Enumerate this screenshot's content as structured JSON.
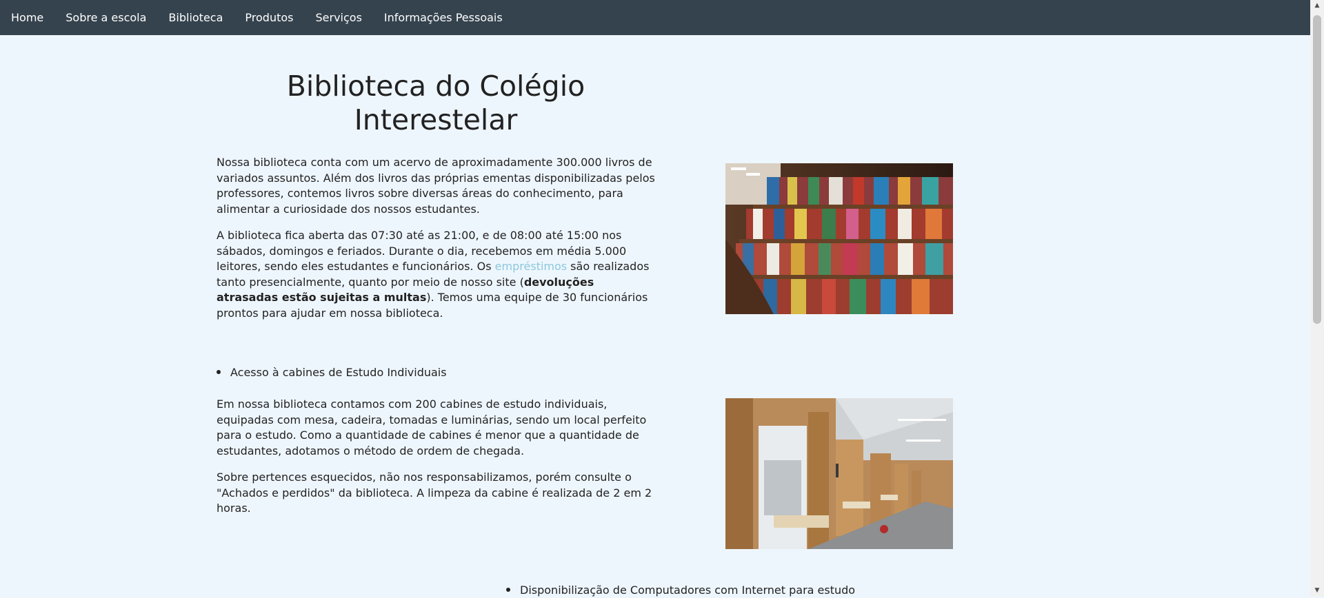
{
  "nav": {
    "items": [
      {
        "label": "Home"
      },
      {
        "label": "Sobre a escola"
      },
      {
        "label": "Biblioteca"
      },
      {
        "label": "Produtos"
      },
      {
        "label": "Serviços"
      },
      {
        "label": "Informações Pessoais"
      }
    ]
  },
  "main": {
    "title": "Biblioteca do Colégio Interestelar",
    "section1": {
      "p1": "Nossa biblioteca conta com um acervo de aproximadamente 300.000 livros de variados assuntos. Além dos livros das próprias ementas disponibilizadas pelos professores, contemos livros sobre diversas áreas do conhecimento, para alimentar a curiosidade dos nossos estudantes.",
      "p2_part1": "A biblioteca fica aberta das 07:30 até as 21:00, e de 08:00 até 15:00 nos sábados, domingos e feriados. Durante o dia, recebemos em média 5.000 leitores, sendo eles estudantes e funcionários. Os ",
      "p2_link": "empréstimos",
      "p2_part2": " são realizados tanto presencialmente, quanto por meio de nosso site (",
      "p2_bold": "devoluções atrasadas estão sujeitas a multas",
      "p2_part3": "). Temos uma equipe de 30 funcionários prontos para ajudar em nossa biblioteca."
    },
    "bullet1": "Acesso à cabines de Estudo Individuais",
    "section2": {
      "p1": "Em nossa biblioteca contamos com 200 cabines de estudo individuais, equipadas com mesa, cadeira, tomadas e luminárias, sendo um local perfeito para o estudo. Como a quantidade de cabines é menor que a quantidade de estudantes, adotamos o método de ordem de chegada.",
      "p2": "Sobre pertences esquecidos, não nos responsabilizamos, porém consulte o \"Achados e perdidos\" da biblioteca. A limpeza da cabine é realizada de 2 em 2 horas."
    },
    "bullet2": "Disponibilização de Computadores com Internet para estudo"
  },
  "colors": {
    "navbar": "#35434e",
    "background": "#eef6fd",
    "link": "#8cc8dd"
  }
}
